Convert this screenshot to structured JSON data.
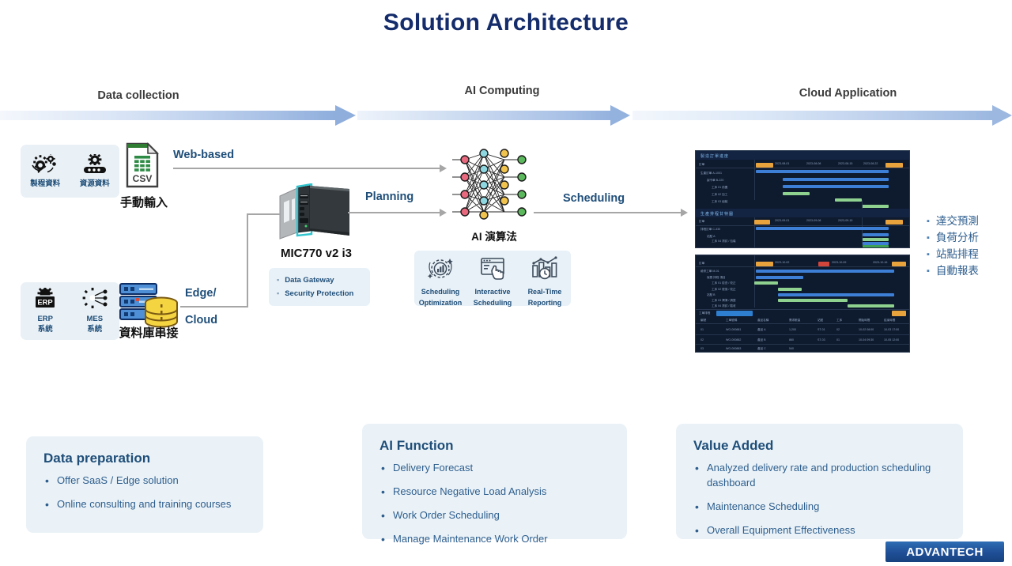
{
  "title": "Solution Architecture",
  "phases": [
    {
      "label": "Data collection"
    },
    {
      "label": "AI Computing"
    },
    {
      "label": "Cloud Application"
    }
  ],
  "data_collection": {
    "process_group": [
      {
        "icon": "gears-icon",
        "caption": "製程資料"
      },
      {
        "icon": "conveyor-gear-icon",
        "caption": "資源資料"
      }
    ],
    "csv": {
      "icon": "csv-file-icon",
      "badge": "CSV",
      "caption": "手動輸入"
    },
    "system_group": [
      {
        "icon": "erp-icon",
        "caption_line1": "ERP",
        "caption_line2": "系統"
      },
      {
        "icon": "mes-icon",
        "caption_line1": "MES",
        "caption_line2": "系統"
      }
    ],
    "database": {
      "icon": "database-server-icon",
      "caption": "資料庫串接"
    }
  },
  "connectors": {
    "web_based": "Web-based",
    "edge_line1": "Edge/",
    "edge_line2": "Cloud",
    "planning": "Planning",
    "scheduling": "Scheduling"
  },
  "edge_device": {
    "icon": "industrial-pc-icon",
    "caption": "MIC770 v2 i3",
    "features": [
      "Data Gateway",
      "Security Protection"
    ]
  },
  "ai": {
    "icon": "neural-network-icon",
    "caption": "AI 演算法",
    "functions": [
      {
        "icon": "scheduling-optimization-icon",
        "line1": "Scheduling",
        "line2": "Optimization"
      },
      {
        "icon": "interactive-scheduling-icon",
        "line1": "Interactive",
        "line2": "Scheduling"
      },
      {
        "icon": "real-time-reporting-icon",
        "line1": "Real-Time",
        "line2": "Reporting"
      }
    ]
  },
  "cloud": {
    "dashboard_top": {
      "name": "gantt-dashboard-screenshot",
      "section1_title": "製造訂單進度",
      "section2_title": "生產排程甘特圖"
    },
    "dashboard_bottom": {
      "name": "scheduling-table-dashboard-screenshot",
      "section_title": "工單排程"
    },
    "bullets": [
      "達交預測",
      "負荷分析",
      "站點排程",
      "自動報表"
    ]
  },
  "cards": [
    {
      "title": "Data preparation",
      "items": [
        "Offer SaaS / Edge solution",
        "Online consulting and training courses"
      ]
    },
    {
      "title": "AI Function",
      "items": [
        "Delivery Forecast",
        "Resource Negative Load Analysis",
        "Work Order Scheduling",
        "Manage Maintenance Work Order"
      ]
    },
    {
      "title": "Value Added",
      "items": [
        "Analyzed delivery rate and production scheduling dashboard",
        "Maintenance Scheduling",
        "Overall Equipment Effectiveness"
      ]
    }
  ],
  "logo": {
    "text": "ADVANTECH"
  },
  "colors": {
    "title": "#142C6B",
    "accent_blue": "#1F4E79",
    "tile_bg": "#EAF1F6",
    "card_bg": "#EAF2F7",
    "arrow_blue": "#8FAEDC",
    "connector_gray": "#A6A6A6",
    "dashboard_bg": "#0E1A2E",
    "logo_blue": "#1F4E96"
  }
}
